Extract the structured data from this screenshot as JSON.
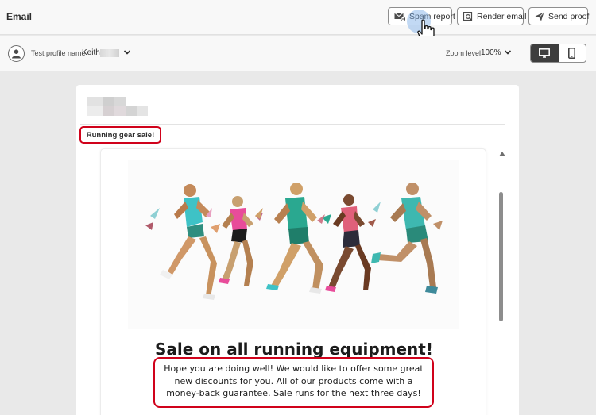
{
  "header": {
    "title": "Email",
    "buttons": {
      "spam_report": "Spam report",
      "render_email": "Render email",
      "send_proof": "Send proof"
    }
  },
  "toolbar": {
    "profile_label": "Test profile name",
    "profile_value": "Keith",
    "zoom_label": "Zoom level",
    "zoom_value": "100%",
    "view_modes": [
      "desktop",
      "mobile"
    ],
    "active_view": "desktop"
  },
  "email": {
    "subject": "Running gear sale!",
    "headline": "Sale on all running equipment!",
    "body": "Hope you are doing well! We would like to offer some great new discounts for you. All of our products come with a money-back guarantee. Sale runs for the next three days!",
    "hero_image": "runners-illustration"
  },
  "colors": {
    "highlight": "#d0021b",
    "active_toggle": "#3d3d3d",
    "cursor_halo": "#78aae6"
  }
}
